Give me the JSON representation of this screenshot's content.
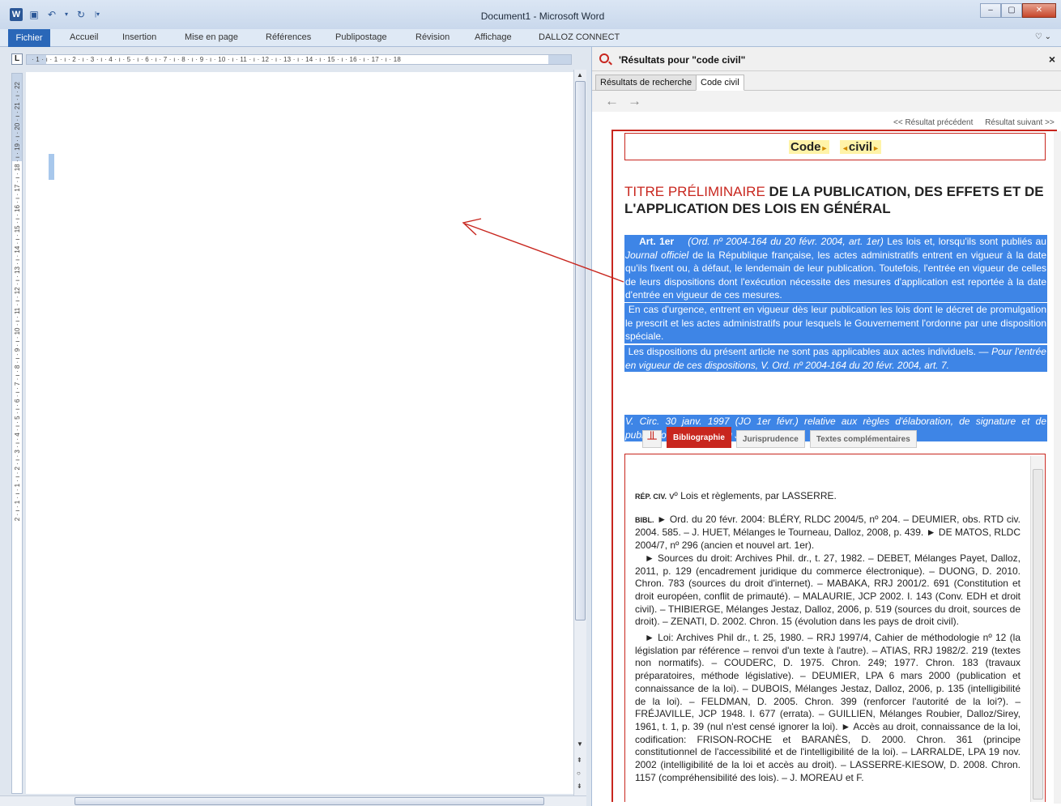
{
  "window": {
    "title": "Document1 - Microsoft Word",
    "logo": "W"
  },
  "ribbon": {
    "tabs": [
      "Fichier",
      "Accueil",
      "Insertion",
      "Mise en page",
      "Références",
      "Publipostage",
      "Révision",
      "Affichage",
      "DALLOZ CONNECT"
    ]
  },
  "rulers": {
    "corner": "L",
    "horizontal": "· 1 · ı · 1 · ı · 2 · ı · 3 · ı · 4 · ı · 5 · ı · 6 · ı · 7 · ı · 8 · ı · 9 · ı · 10 · ı · 11 · ı · 12 · ı · 13 · ı · 14 · ı · 15 · ı · 16 · ı · 17 · ı · 18",
    "vertical": "2 · ı · 1 · ı · 1 · ı · 2 · ı · 3 · ı · 4 · ı · 5 · ı · 6 · ı · 7 · ı · 8 · ı · 9 · ı · 10 · ı · 11 · ı · 12 · ı · 13 · ı · 14 · ı · 15 · ı · 16 · ı · 17 · ı · 18 · ı · 19 · ı · 20 · ı · 21 · ı · 22"
  },
  "pane": {
    "title": "'Résultats pour \"code civil\"",
    "close": "×",
    "tabs": [
      "Résultats de recherche",
      "Code civil"
    ],
    "back": "←",
    "forward": "→",
    "prev_result": "<< Résultat précédent",
    "next_result": "Résultat suivant >>",
    "code_word": "Code",
    "civil_word": "civil",
    "titre_red": "TITRE PRÉLIMINAIRE",
    "titre_black": "DE LA PUBLICATION, DES EFFETS ET DE L'APPLICATION DES LOIS EN GÉNÉRAL",
    "art1_label": "Art. 1er",
    "art1_ref": "(Ord. nº 2004-164 du 20 févr. 2004, art. 1er)",
    "art1_text_a": "Les lois et, lorsqu'ils sont publiés au",
    "art1_jo": "Journal officiel",
    "art1_text_b": "de la République française, les actes administratifs entrent en vigueur à la date qu'ils fixent ou, à défaut, le lendemain de leur publication. Toutefois, l'entrée en vigueur de celles de leurs dispositions dont l'exécution nécessite des mesures d'application est reportée à la date d'entrée en vigueur de ces mesures.",
    "par2": "En cas d'urgence, entrent en vigueur dès leur publication les lois dont le décret de promulgation le prescrit et les actes administratifs pour lesquels le Gouvernement l'ordonne par une disposition spéciale.",
    "par3": "Les dispositions du présent article ne sont pas applicables aux actes individuels. —",
    "par3_italic": "Pour l'entrée en vigueur de ces dispositions, V. Ord. nº 2004-164 du 20 févr. 2004, art. 7.",
    "par5": "V. Circ. 30 janv. 1997 (JO 1er févr.) relative aux règles d'élaboration, de signature et de publication des textes au Journal officiel.",
    "bottom_tabs": [
      "Bibliographie",
      "Jurisprudence",
      "Textes complémentaires"
    ],
    "biblio_rep_label": "RÉP. CIV.",
    "biblio_rep_text": "vº Lois et règlements, par LASSERRE.",
    "biblio_bibl_label": "BIBL.",
    "biblio_p1": "► Ord. du 20 févr. 2004: BLÉRY, RLDC 2004/5, nº 204. – DEUMIER, obs. RTD civ. 2004. 585. – J. HUET, Mélanges le Tourneau, Dalloz, 2008, p. 439. ► DE MATOS, RLDC 2004/7, nº 296 (ancien et nouvel art. 1er).",
    "biblio_p2": "► Sources du droit: Archives Phil. dr., t. 27, 1982. – DEBET, Mélanges Payet, Dalloz, 2011, p. 129 (encadrement juridique du commerce électronique). – DUONG, D. 2010. Chron. 783 (sources du droit d'internet). – MABAKA, RRJ 2001/2. 691 (Constitution et droit européen, conflit de primauté). – MALAURIE, JCP 2002. I. 143 (Conv. EDH et droit civil). – THIBIERGE, Mélanges Jestaz, Dalloz, 2006, p. 519 (sources du droit, sources de droit). – ZENATI, D. 2002. Chron. 15 (évolution dans les pays de droit civil).",
    "biblio_p3": "► Loi: Archives Phil dr., t. 25, 1980. – RRJ 1997/4, Cahier de méthodologie nº 12 (la législation par référence – renvoi d'un texte à l'autre). – ATIAS, RRJ 1982/2. 219 (textes non normatifs). – COUDERC, D. 1975. Chron. 249; 1977. Chron. 183 (travaux préparatoires, méthode législative). – DEUMIER, LPA 6 mars 2000 (publication et connaissance de la loi). – DUBOIS, Mélanges Jestaz, Dalloz, 2006, p. 135 (intelligibilité de la loi). – FELDMAN, D. 2005. Chron. 399 (renforcer l'autorité de la loi?). – FRÉJAVILLE, JCP 1948. I. 677 (errata). – GUILLIEN, Mélanges Roubier, Dalloz/Sirey, 1961, t. 1, p. 39 (nul n'est censé ignorer la loi). ► Accès au droit, connaissance de la loi, codification: FRISON-ROCHE et BARANÈS, D. 2000. Chron. 361 (principe constitutionnel de l'accessibilité et de l'intelligibilité de la loi). – LARRALDE, LPA 19 nov. 2002 (intelligibilité de la loi et accès au droit). – LASSERRE-KIESOW, D. 2008. Chron. 1157 (compréhensibilité des lois). – J. MOREAU et F."
  },
  "colors": {
    "accent_red": "#c8261e",
    "selection_blue": "#3e85e6",
    "highlight_yellow": "#fff3a8",
    "word_blue": "#2a67b8"
  },
  "icons": {
    "search": "search-icon",
    "close": "close-icon",
    "back": "back-arrow-icon",
    "forward": "forward-arrow-icon",
    "bookmark": "bookmark-icon"
  }
}
